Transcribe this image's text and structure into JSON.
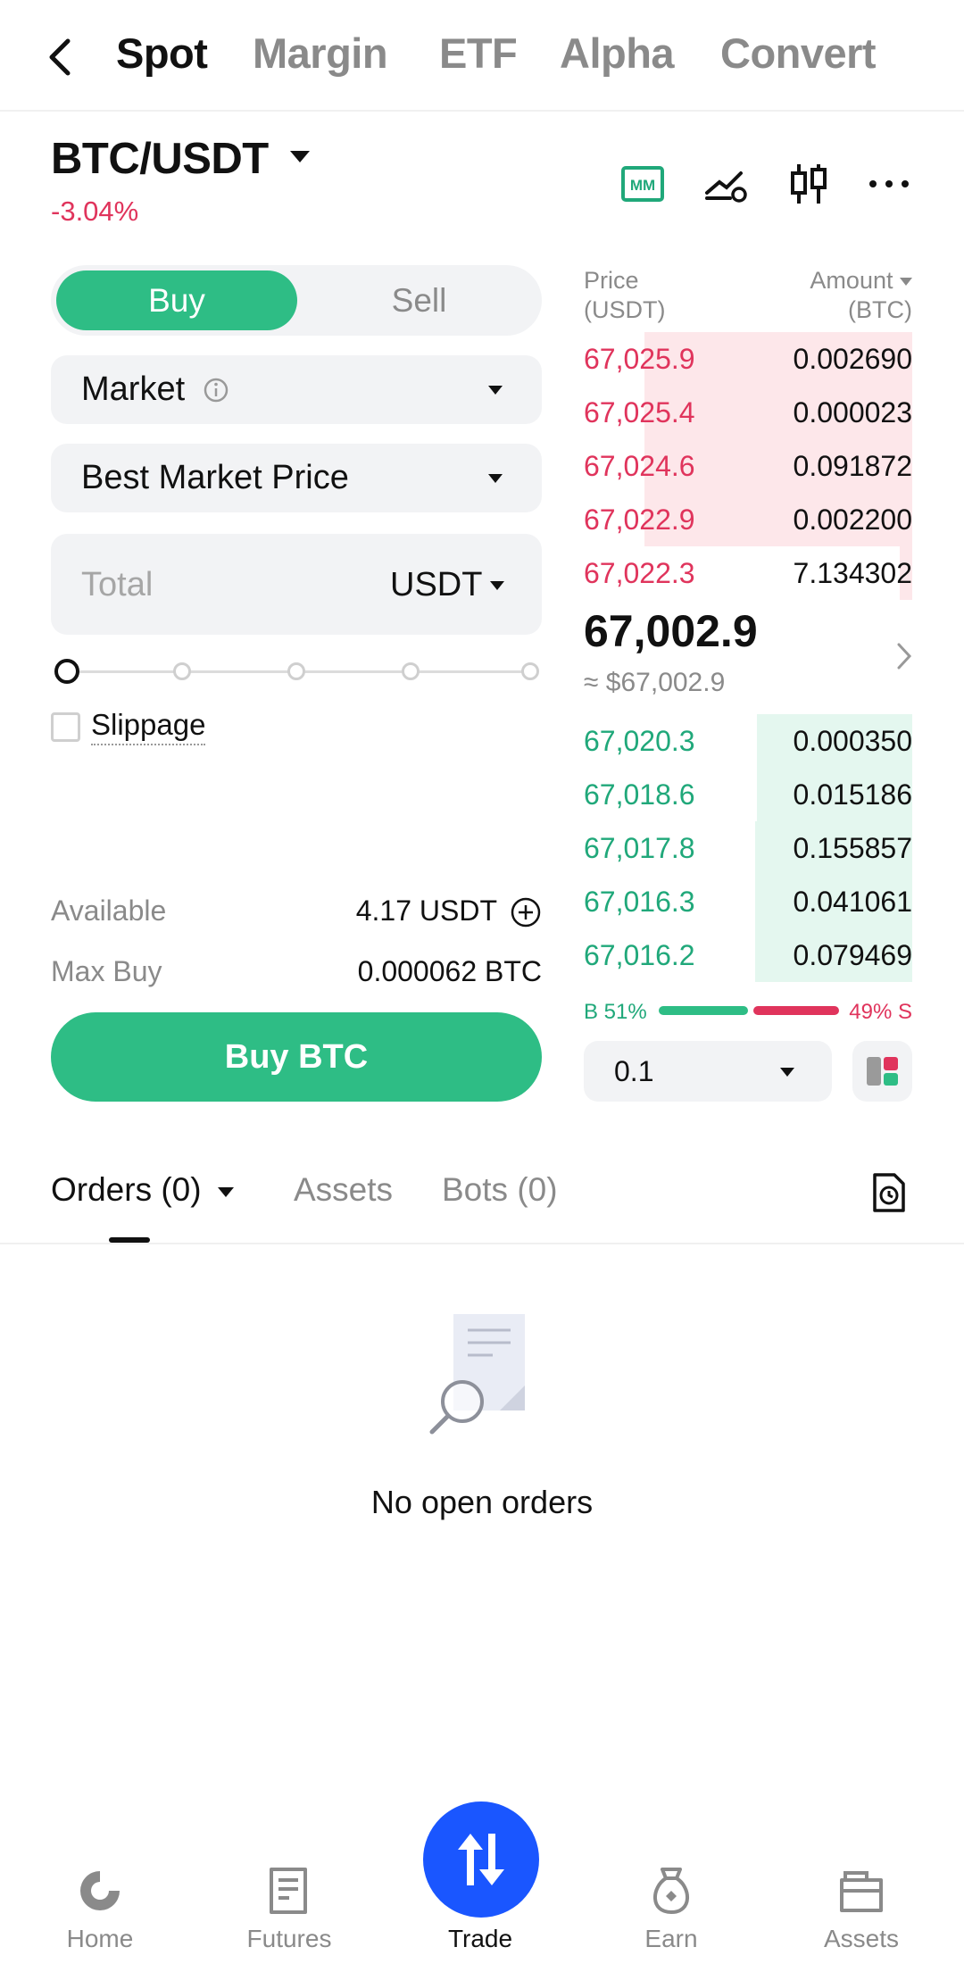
{
  "top_tabs": [
    "Spot",
    "Margin",
    "ETF",
    "Alpha",
    "Convert"
  ],
  "pair": {
    "name": "BTC/USDT",
    "change": "-3.04%"
  },
  "header_icons": [
    "mm-icon",
    "price-alert-icon",
    "candlestick-icon",
    "more-icon"
  ],
  "header_mm_label": "MM",
  "order_form": {
    "buy_label": "Buy",
    "sell_label": "Sell",
    "order_type": "Market",
    "price_mode": "Best Market Price",
    "total_placeholder": "Total",
    "total_unit": "USDT",
    "slider_value_percent": 0,
    "slippage_label": "Slippage",
    "available_label": "Available",
    "available_value": "4.17 USDT",
    "max_buy_label": "Max Buy",
    "max_buy_value": "0.000062 BTC",
    "submit_label": "Buy BTC"
  },
  "orderbook": {
    "price_header": "Price",
    "price_unit": "(USDT)",
    "amount_header": "Amount",
    "amount_unit": "(BTC)",
    "asks": [
      {
        "price": "67,025.9",
        "amount": "0.002690"
      },
      {
        "price": "67,025.4",
        "amount": "0.000023"
      },
      {
        "price": "67,024.6",
        "amount": "0.091872"
      },
      {
        "price": "67,022.9",
        "amount": "0.002200"
      },
      {
        "price": "67,022.3",
        "amount": "7.134302"
      }
    ],
    "last_price": "67,002.9",
    "last_price_usd": "≈ $67,002.9",
    "bids": [
      {
        "price": "67,020.3",
        "amount": "0.000350"
      },
      {
        "price": "67,018.6",
        "amount": "0.015186"
      },
      {
        "price": "67,017.8",
        "amount": "0.155857"
      },
      {
        "price": "67,016.3",
        "amount": "0.041061"
      },
      {
        "price": "67,016.2",
        "amount": "0.079469"
      }
    ],
    "buy_ratio_label": "B 51%",
    "sell_ratio_label": "49% S",
    "buy_ratio": 0.51,
    "precision": "0.1"
  },
  "orders_tabs": [
    "Orders (0)",
    "Assets",
    "Bots (0)"
  ],
  "empty_state": "No open orders",
  "bottom_nav": [
    "Home",
    "Futures",
    "Trade",
    "Earn",
    "Assets"
  ],
  "colors": {
    "green": "#2ebd85",
    "red": "#e0345c",
    "trade_blue": "#1a56ff"
  }
}
